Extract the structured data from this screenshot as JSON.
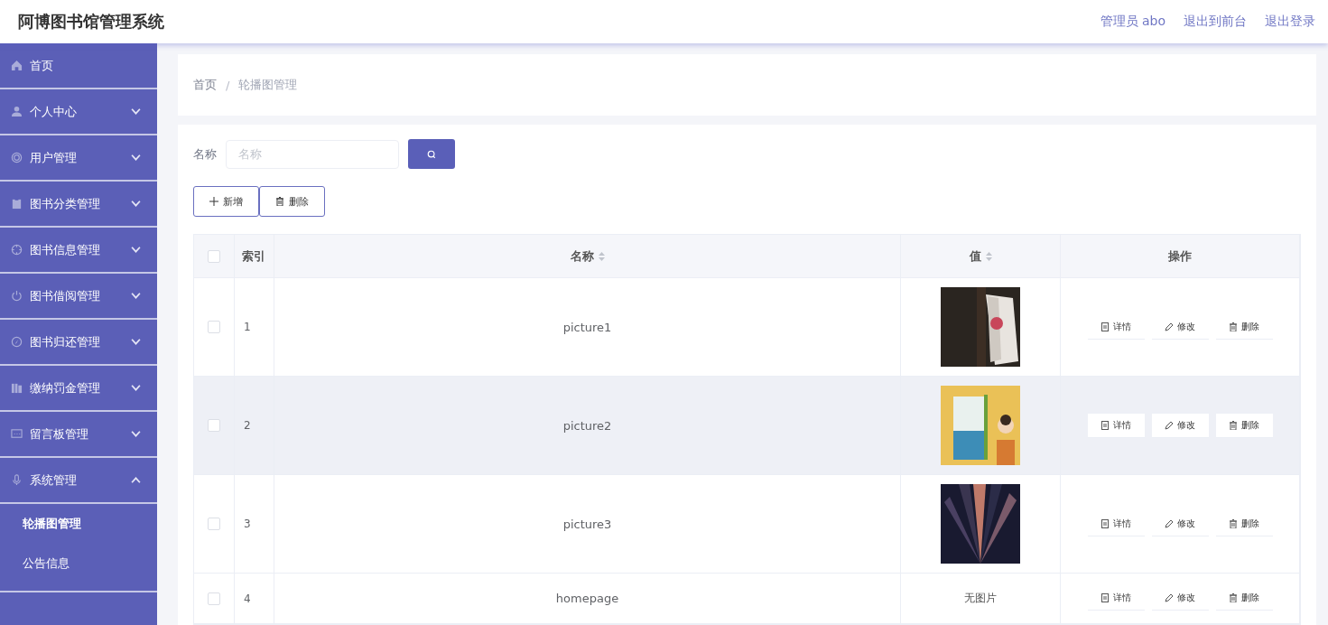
{
  "header": {
    "title": "阿博图书馆管理系统",
    "links": [
      "管理员 abo",
      "退出到前台",
      "退出登录"
    ]
  },
  "sidebar": {
    "items": [
      {
        "label": "首页"
      },
      {
        "label": "个人中心",
        "expanded": false
      },
      {
        "label": "用户管理",
        "expanded": false
      },
      {
        "label": "图书分类管理",
        "expanded": false
      },
      {
        "label": "图书信息管理",
        "expanded": false
      },
      {
        "label": "图书借阅管理",
        "expanded": false
      },
      {
        "label": "图书归还管理",
        "expanded": false
      },
      {
        "label": "缴纳罚金管理",
        "expanded": false
      },
      {
        "label": "留言板管理",
        "expanded": false
      },
      {
        "label": "系统管理",
        "expanded": true,
        "children": [
          {
            "label": "轮播图管理",
            "selected": true
          },
          {
            "label": "公告信息",
            "selected": false
          }
        ]
      }
    ]
  },
  "breadcrumb": {
    "items": [
      "首页",
      "轮播图管理"
    ],
    "separator": "/"
  },
  "search": {
    "label": "名称",
    "placeholder": "名称"
  },
  "toolbar": [
    "新增",
    "删除"
  ],
  "table": {
    "all_checked": false,
    "columns": [
      {
        "label": "索引",
        "sortable": false
      },
      {
        "label": "名称",
        "sortable": true
      },
      {
        "label": "值",
        "sortable": true
      },
      {
        "label": "操作",
        "sortable": false
      }
    ],
    "rows": [
      {
        "index": "1",
        "name": "picture1",
        "value": {
          "kind": "picture"
        },
        "checked": false,
        "hovered": false,
        "actions": [
          "详情",
          "修改",
          "删除"
        ]
      },
      {
        "index": "2",
        "name": "picture2",
        "value": {
          "kind": "picture"
        },
        "checked": false,
        "hovered": true,
        "actions": [
          "详情",
          "修改",
          "删除"
        ]
      },
      {
        "index": "3",
        "name": "picture3",
        "value": {
          "kind": "picture"
        },
        "checked": false,
        "hovered": false,
        "actions": [
          "详情",
          "修改",
          "删除"
        ]
      },
      {
        "index": "4",
        "name": "homepage",
        "value": {
          "kind": "text",
          "text": "无图片"
        },
        "checked": false,
        "hovered": false,
        "actions": [
          "详情",
          "修改",
          "删除"
        ]
      }
    ]
  }
}
